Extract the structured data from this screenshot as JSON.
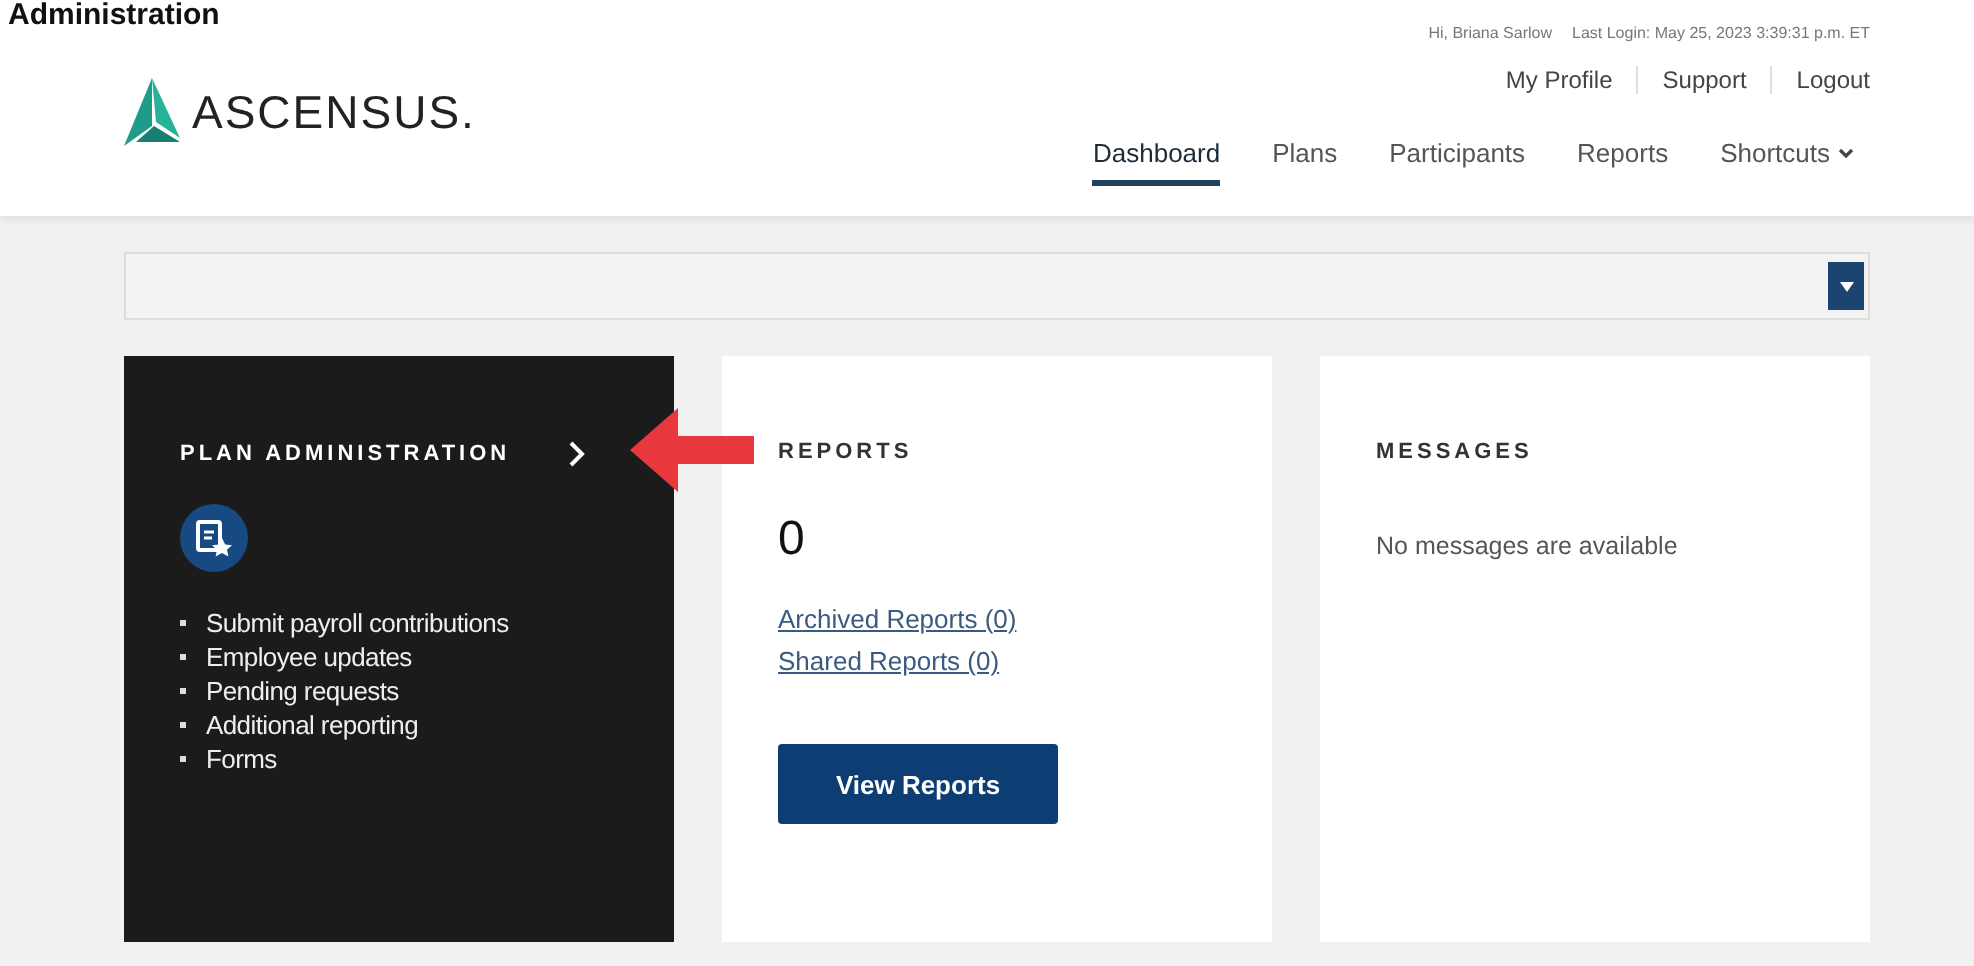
{
  "page_heading": "Administration",
  "header": {
    "greeting": "Hi, Briana Sarlow",
    "last_login": "Last Login: May 25, 2023 3:39:31 p.m. ET",
    "logo": "ASCENSUS.",
    "links": [
      "My Profile",
      "Support",
      "Logout"
    ],
    "nav": [
      {
        "label": "Dashboard",
        "selected": true,
        "caret": false
      },
      {
        "label": "Plans",
        "selected": false,
        "caret": false
      },
      {
        "label": "Participants",
        "selected": false,
        "caret": false
      },
      {
        "label": "Reports",
        "selected": false,
        "caret": false
      },
      {
        "label": "Shortcuts",
        "selected": false,
        "caret": true
      }
    ]
  },
  "cards": [
    {
      "kind": "plan",
      "title": "PLAN ADMINISTRATION",
      "items": [
        "Submit payroll contributions",
        "Employee updates",
        "Pending requests",
        "Additional reporting",
        "Forms"
      ]
    },
    {
      "kind": "reports",
      "title": "REPORTS",
      "count": "0",
      "links": [
        "Archived Reports (0)",
        "Shared Reports (0)"
      ],
      "button": "View Reports"
    },
    {
      "kind": "messages",
      "title": "MESSAGES",
      "text": "No messages are available"
    }
  ]
}
